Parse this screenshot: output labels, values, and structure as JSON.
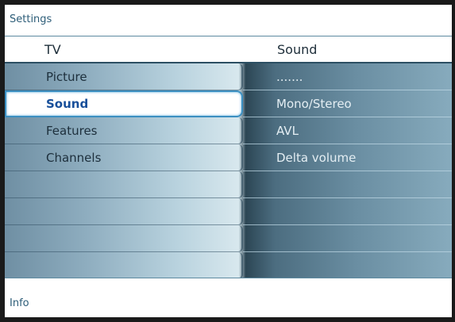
{
  "title": "Settings",
  "header": {
    "left": "TV",
    "right": "Sound"
  },
  "left_menu": [
    {
      "label": "Picture",
      "selected": false
    },
    {
      "label": "Sound",
      "selected": true
    },
    {
      "label": "Features",
      "selected": false
    },
    {
      "label": "Channels",
      "selected": false
    },
    {
      "label": "",
      "selected": false
    },
    {
      "label": "",
      "selected": false
    },
    {
      "label": "",
      "selected": false
    },
    {
      "label": "",
      "selected": false
    }
  ],
  "right_menu": [
    {
      "label": "......."
    },
    {
      "label": "Mono/Stereo"
    },
    {
      "label": "AVL"
    },
    {
      "label": "Delta volume"
    },
    {
      "label": ""
    },
    {
      "label": ""
    },
    {
      "label": ""
    },
    {
      "label": ""
    }
  ],
  "info": "Info",
  "colors": {
    "accent": "#3c8fc1",
    "title_text": "#2d5d78"
  }
}
